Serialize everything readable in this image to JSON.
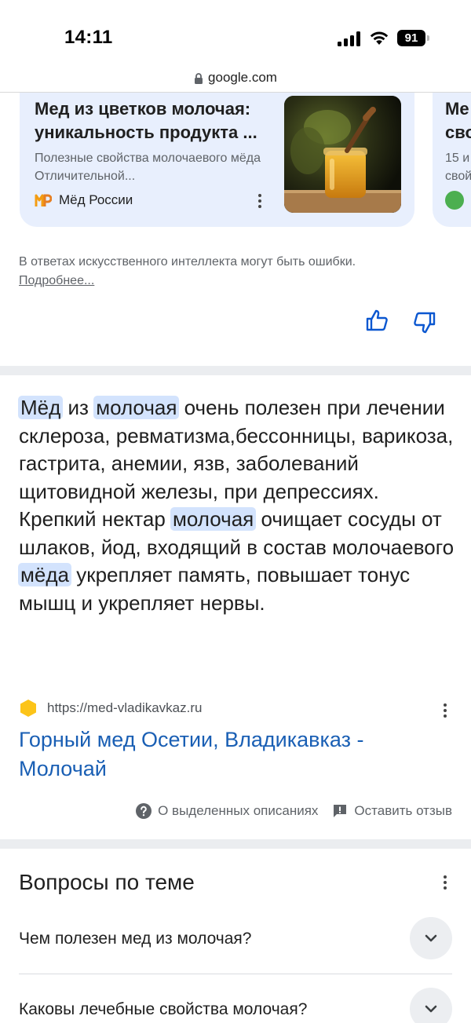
{
  "status_bar": {
    "time": "14:11",
    "battery": "91"
  },
  "url_bar": {
    "domain": "google.com"
  },
  "source_cards": [
    {
      "title": "Мед из цветков молочая: уникальность продукта ...",
      "snippet": "Полезные свойства молочаевого мёда Отличительной...",
      "source": "Мёд России",
      "logo_text": "MP"
    },
    {
      "title_partial": [
        "Ме",
        "сво"
      ],
      "snippet_partial": [
        "15 и",
        "свой"
      ]
    }
  ],
  "ai_overview": {
    "disclaimer": "В ответах искусственного интеллекта могут быть ошибки.",
    "more_link": "Подробнее..."
  },
  "featured_snippet": {
    "parts": [
      {
        "text": "Мёд",
        "hl": true
      },
      {
        "text": " из ",
        "hl": false
      },
      {
        "text": "молочая",
        "hl": true
      },
      {
        "text": " очень полезен при лечении склероза, ревматизма,бессонницы, варикоза, гастрита, анемии, язв, заболеваний щитовидной железы, при депрессиях. Крепкий нектар ",
        "hl": false
      },
      {
        "text": "молочая",
        "hl": true
      },
      {
        "text": " очищает сосуды от шлаков, йод, входящий в состав молочаевого ",
        "hl": false
      },
      {
        "text": "мёда",
        "hl": true
      },
      {
        "text": " укрепляет память, повышает тонус мышц и укрепляет нервы.",
        "hl": false
      }
    ],
    "url": "https://med-vladikavkaz.ru",
    "title": "Горный мед Осетии, Владикавказ - Молочай",
    "about_label": "О выделенных описаниях",
    "feedback_label": "Оставить отзыв"
  },
  "people_also_ask": {
    "heading": "Вопросы по теме",
    "questions": [
      "Чем полезен мед из молочая?",
      "Каковы лечебные свойства молочая?"
    ]
  },
  "colors": {
    "link_blue": "#1a5fb4",
    "highlight": "#d3e3fd",
    "card_bg": "#e8effd",
    "thumb_blue": "#0b57d0"
  }
}
